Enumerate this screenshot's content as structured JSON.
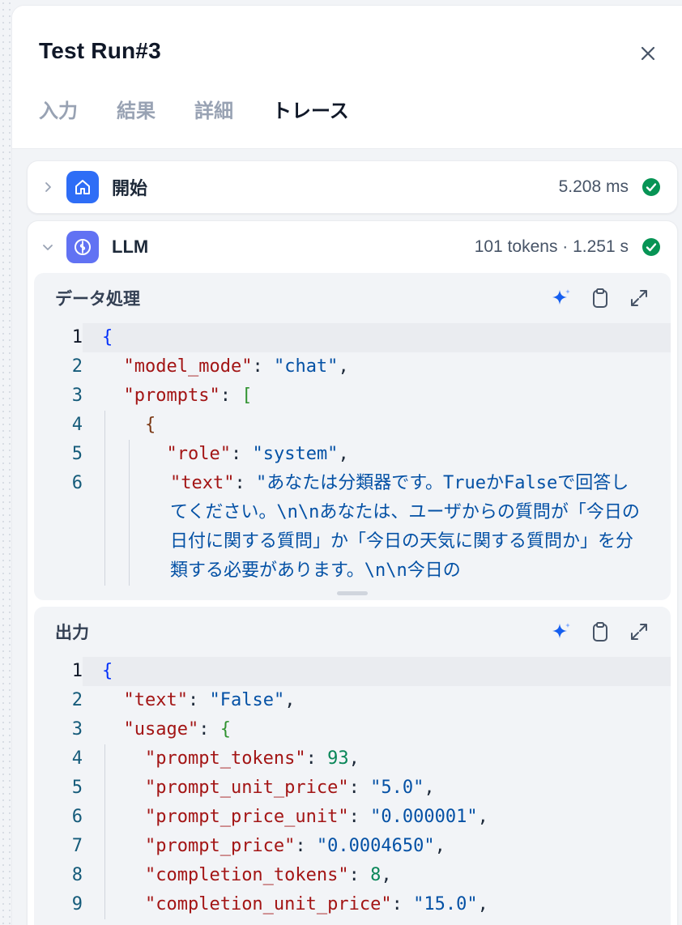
{
  "panel": {
    "title": "Test Run#3",
    "tabs": [
      {
        "label": "入力",
        "active": false
      },
      {
        "label": "結果",
        "active": false
      },
      {
        "label": "詳細",
        "active": false
      },
      {
        "label": "トレース",
        "active": true
      }
    ]
  },
  "nodes": {
    "start": {
      "name": "開始",
      "meta": "5.208 ms",
      "status": "success",
      "icon": "home-icon"
    },
    "llm": {
      "name": "LLM",
      "meta": "101 tokens · 1.251 s",
      "status": "success",
      "icon": "brain-icon"
    }
  },
  "data_processing": {
    "title": "データ処理",
    "lines": [
      "1",
      "2",
      "3",
      "4",
      "5",
      "6"
    ],
    "code": {
      "model_mode_key": "\"model_mode\"",
      "model_mode_val": "\"chat\"",
      "prompts_key": "\"prompts\"",
      "role_key": "\"role\"",
      "role_val": "\"system\"",
      "text_key": "\"text\"",
      "text_val": "\"あなたは分類器です。TrueかFalseで回答してください。\\n\\nあなたは、ユーザからの質問が「今日の日付に関する質問」か「今日の天気に関する質問か」を分類する必要があります。\\n\\n今日の"
    }
  },
  "output": {
    "title": "出力",
    "lines": [
      "1",
      "2",
      "3",
      "4",
      "5",
      "6",
      "7",
      "8",
      "9"
    ],
    "code": {
      "text_key": "\"text\"",
      "text_val": "\"False\"",
      "usage_key": "\"usage\"",
      "prompt_tokens_key": "\"prompt_tokens\"",
      "prompt_tokens_val": "93",
      "prompt_unit_price_key": "\"prompt_unit_price\"",
      "prompt_unit_price_val": "\"5.0\"",
      "prompt_price_unit_key": "\"prompt_price_unit\"",
      "prompt_price_unit_val": "\"0.000001\"",
      "prompt_price_key": "\"prompt_price\"",
      "prompt_price_val": "\"0.0004650\"",
      "completion_tokens_key": "\"completion_tokens\"",
      "completion_tokens_val": "8",
      "completion_unit_price_key": "\"completion_unit_price\"",
      "completion_unit_price_val": "\"15.0\""
    }
  },
  "colors": {
    "accent": "#155eef",
    "success": "#079455",
    "start_icon_bg": "#2e6df6",
    "llm_icon_bg": "#6172f3"
  }
}
